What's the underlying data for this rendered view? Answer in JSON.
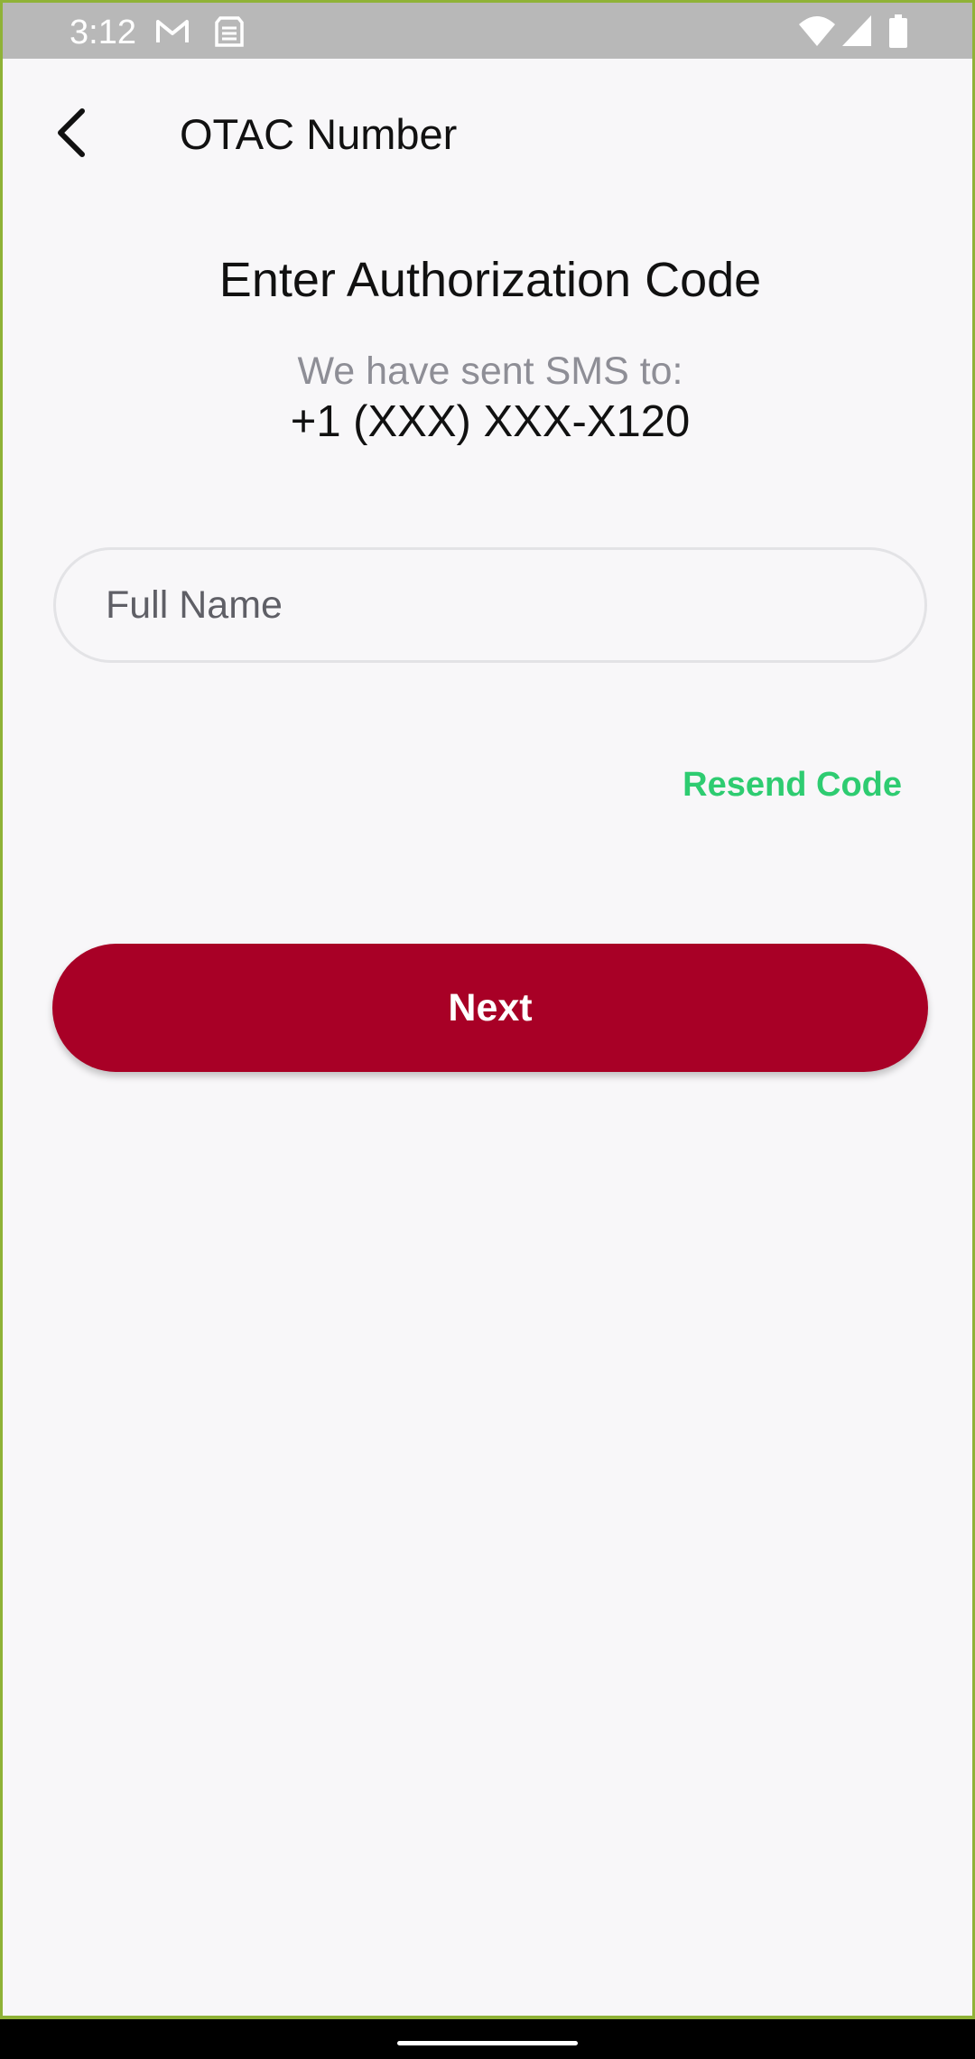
{
  "status_bar": {
    "time": "3:12",
    "left_icons": [
      "gmail-icon",
      "sim-icon"
    ],
    "right_icons": [
      "wifi-icon",
      "cellular-signal-icon",
      "battery-icon"
    ]
  },
  "app_bar": {
    "title": "OTAC Number",
    "back_icon": "arrow-back-icon"
  },
  "content": {
    "heading": "Enter Authorization Code",
    "sent_label": "We have sent SMS to:",
    "phone_number": "+1 (XXX) XXX-X120",
    "input": {
      "value": "",
      "placeholder": "Full Name"
    },
    "resend_label": "Resend Code",
    "next_label": "Next"
  },
  "colors": {
    "accent": "#a80026",
    "link": "#2ecc71",
    "background": "#f8f7f9",
    "status_bar": "#b8b8b8"
  }
}
